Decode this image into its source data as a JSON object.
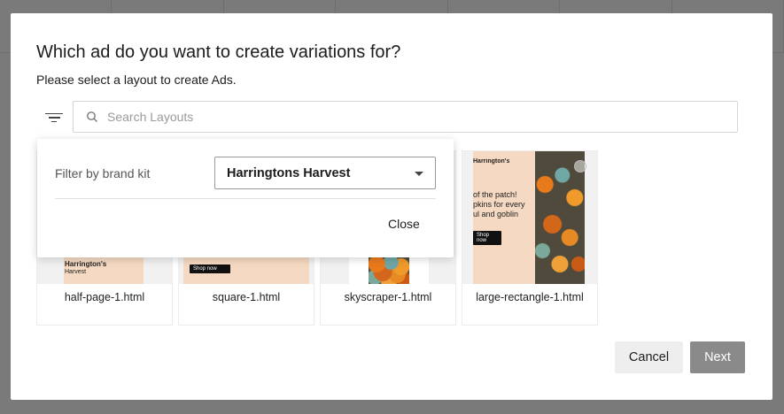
{
  "dialog": {
    "title": "Which ad do you want to create variations for?",
    "subtitle": "Please select a layout to create Ads."
  },
  "search": {
    "placeholder": "Search Layouts",
    "value": ""
  },
  "filter_panel": {
    "label": "Filter by brand kit",
    "selected": "Harringtons Harvest",
    "close_label": "Close"
  },
  "layouts": [
    {
      "name": "half-page-1.html",
      "thumb_brand": "Harrington's",
      "thumb_sub": "Harvest"
    },
    {
      "name": "square-1.html",
      "thumb_cta": "Shop now"
    },
    {
      "name": "skyscraper-1.html"
    },
    {
      "name": "large-rectangle-1.html",
      "thumb_brand": "Harrington's",
      "thumb_text": "of the patch! pkins for every ul and goblin",
      "thumb_cta": "Shop now"
    }
  ],
  "footer": {
    "cancel_label": "Cancel",
    "next_label": "Next"
  },
  "colors": {
    "overlay": "#7a7a7a",
    "thumb_peach": "#f5d9c2",
    "next_disabled": "#8a8a8a"
  }
}
